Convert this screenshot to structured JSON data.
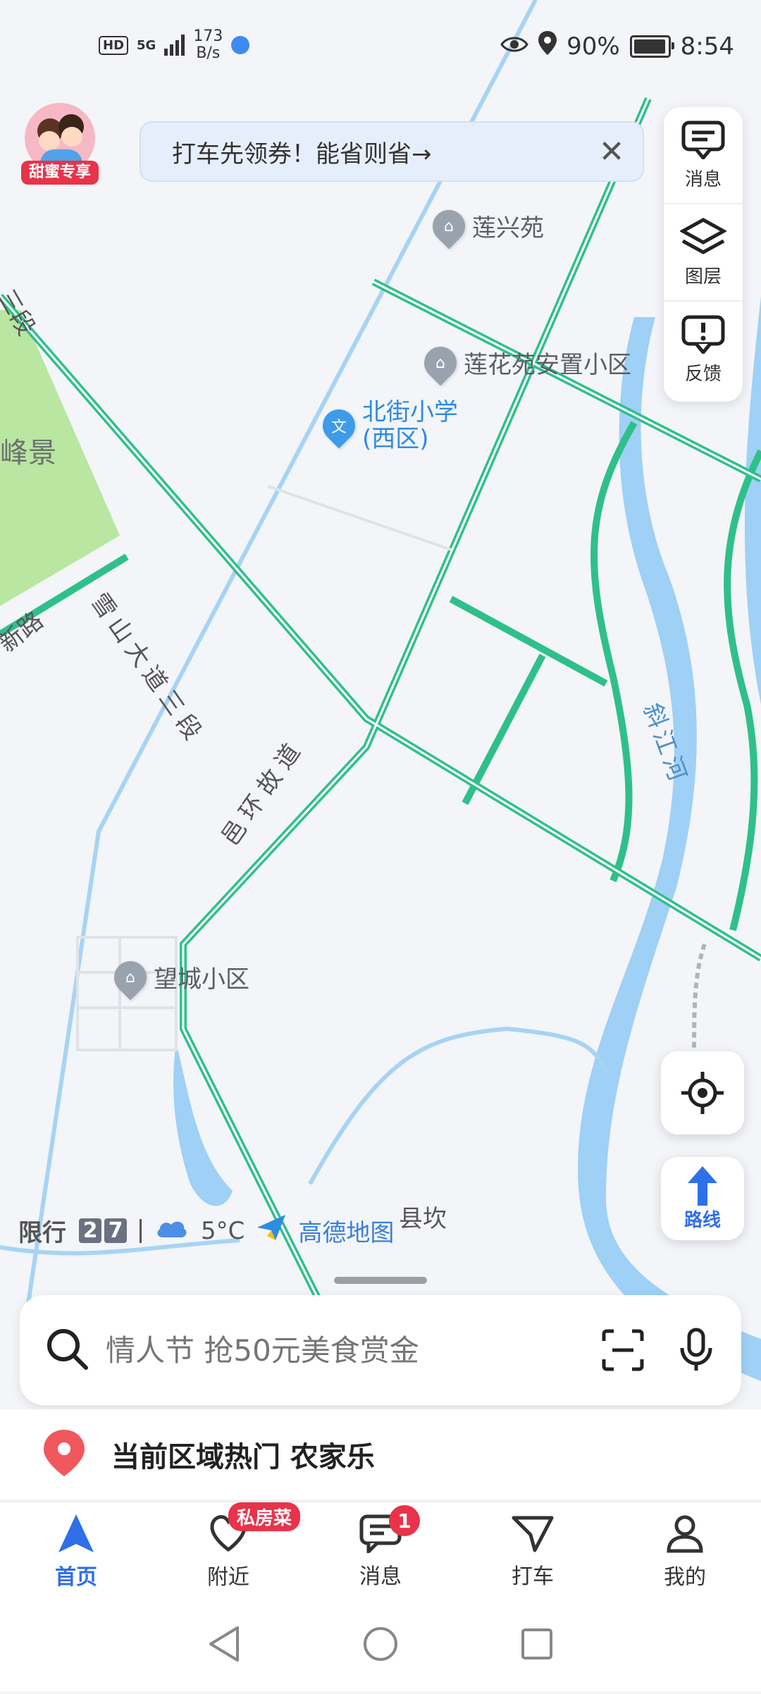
{
  "status_bar": {
    "hd": "HD",
    "network": "5G",
    "speed_value": "173",
    "speed_unit": "B/s",
    "battery": "90%",
    "time": "8:54"
  },
  "promo": {
    "ribbon": "甜蜜专享"
  },
  "coupon_banner": {
    "text": "打车先领券！能省则省→"
  },
  "tools": [
    {
      "label": "消息",
      "icon": "message-icon"
    },
    {
      "label": "图层",
      "icon": "layers-icon"
    },
    {
      "label": "反馈",
      "icon": "feedback-icon"
    }
  ],
  "map": {
    "roads": [
      "雪山大道三段",
      "邑环故道",
      "斜江河",
      "新路",
      "三段",
      "峰景",
      "县坎"
    ],
    "pois": {
      "lianxingyuan": "莲兴苑",
      "lianhuayuan": "莲花苑安置小区",
      "beijie": "北街小学",
      "beijie_sub": "(西区)",
      "wangcheng": "望城小区"
    }
  },
  "map_info": {
    "restriction_label": "限行",
    "restriction_digits": [
      "2",
      "7"
    ],
    "weather": "5°C",
    "brand": "高德地图"
  },
  "route_button": {
    "label": "路线"
  },
  "search": {
    "placeholder": "情人节 抢50元美食赏金"
  },
  "hot_row": {
    "text": "当前区域热门 农家乐"
  },
  "bottom_nav": {
    "items": [
      {
        "label": "首页",
        "active": true
      },
      {
        "label": "附近",
        "tag": "私房菜"
      },
      {
        "label": "消息",
        "badge": "1"
      },
      {
        "label": "打车"
      },
      {
        "label": "我的"
      }
    ]
  },
  "colors": {
    "accent": "#2f6fe8",
    "road": "#2fc08a",
    "water": "#9fd0f5",
    "park": "#b9e6a0",
    "badge": "#e8334a"
  }
}
